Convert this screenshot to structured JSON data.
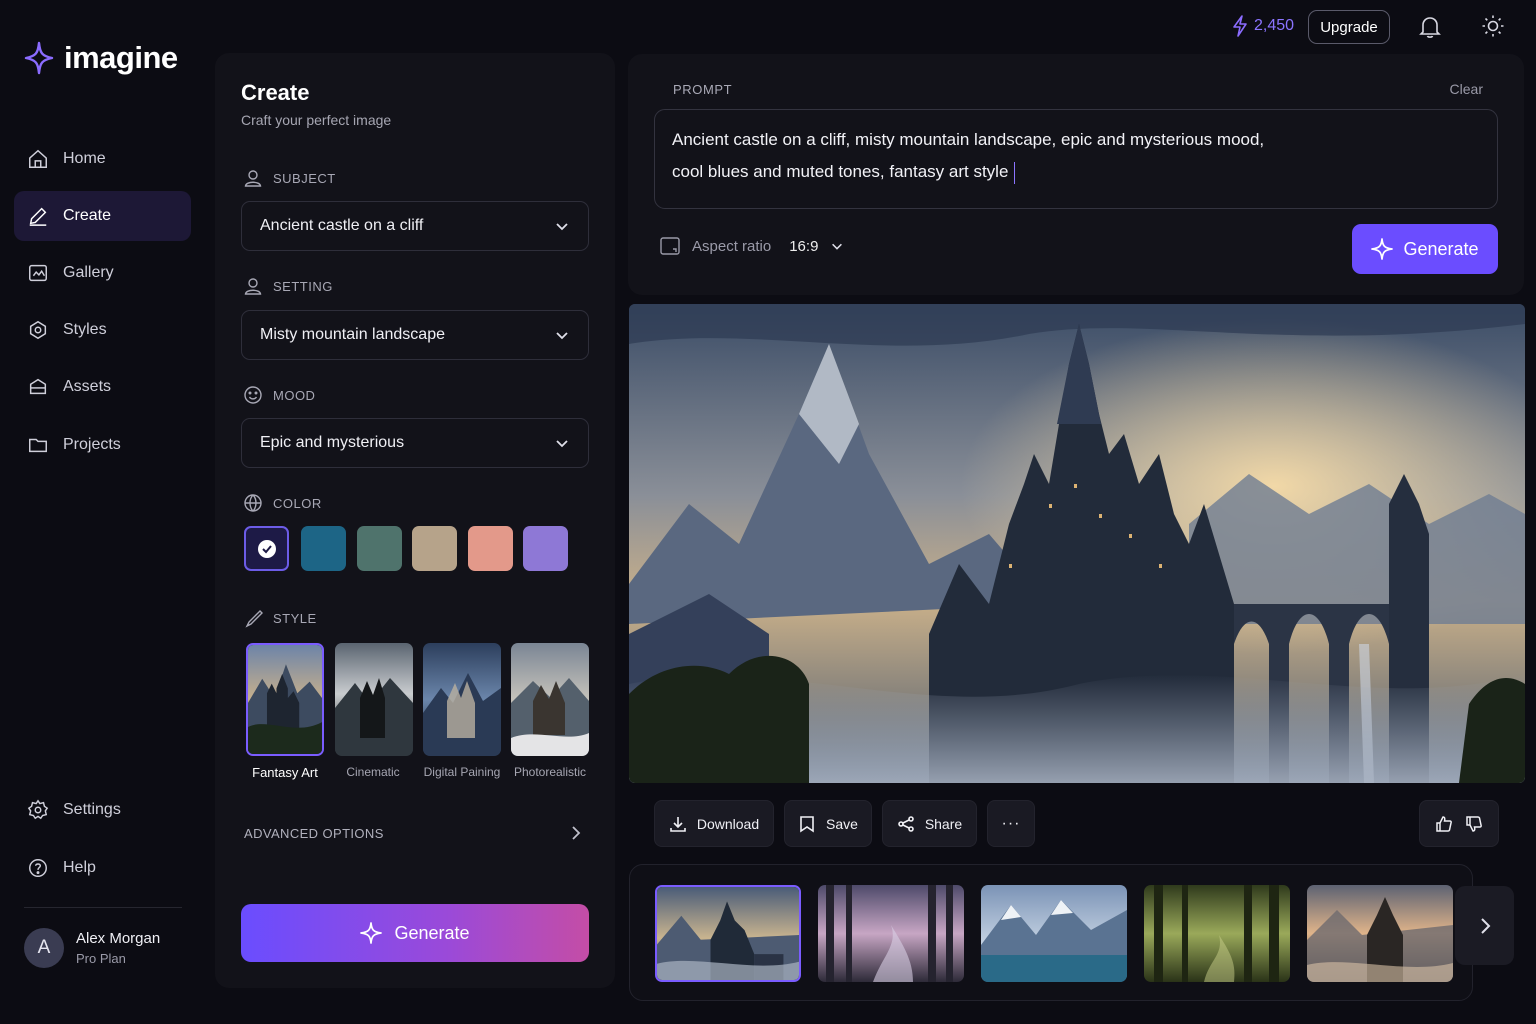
{
  "app": {
    "logo": "imagine"
  },
  "sidebar": {
    "items": [
      {
        "label": "Home",
        "icon": "home-icon"
      },
      {
        "label": "Create",
        "icon": "pen-icon",
        "active": true
      },
      {
        "label": "Gallery",
        "icon": "gallery-icon"
      },
      {
        "label": "Styles",
        "icon": "palette-icon"
      },
      {
        "label": "Assets",
        "icon": "box-icon"
      },
      {
        "label": "Projects",
        "icon": "folder-icon"
      }
    ],
    "bottom_items": [
      {
        "label": "Settings",
        "icon": "gear-icon"
      },
      {
        "label": "Help",
        "icon": "help-icon"
      }
    ],
    "user": {
      "initial": "A",
      "name": "Alex Morgan",
      "plan": "Pro Plan"
    }
  },
  "header": {
    "credits": "2,450",
    "upgrade_label": "Upgrade"
  },
  "create_panel": {
    "title": "Create",
    "subtitle": "Craft your perfect image",
    "subject": {
      "label": "SUBJECT",
      "value": "Ancient castle on a cliff"
    },
    "setting": {
      "label": "SETTING",
      "value": "Misty mountain landscape"
    },
    "mood": {
      "label": "MOOD",
      "value": "Epic and mysterious"
    },
    "color": {
      "label": "COLOR",
      "swatches": [
        "#1e1a4a",
        "#1d6586",
        "#4f736c",
        "#b6a38a",
        "#e3998a",
        "#8e78d6"
      ],
      "selected_index": 0
    },
    "style": {
      "label": "STYLE",
      "options": [
        "Fantasy Art",
        "Cinematic",
        "Digital Paining",
        "Photorealistic"
      ],
      "selected_index": 0
    },
    "advanced_label": "ADVANCED OPTIONS",
    "generate_label": "Generate"
  },
  "prompt": {
    "label": "PROMPT",
    "clear_label": "Clear",
    "line1": "Ancient castle on a cliff, misty mountain landscape, epic and mysterious mood,",
    "line2": "cool blues and muted tones, fantasy art style",
    "aspect_label": "Aspect ratio",
    "aspect_value": "16:9",
    "generate_label": "Generate"
  },
  "actions": {
    "download": "Download",
    "save": "Save",
    "share": "Share",
    "more": "···"
  },
  "colors": {
    "accent": "#6b4dff",
    "bg": "#0c0c13",
    "panel": "#121219"
  }
}
